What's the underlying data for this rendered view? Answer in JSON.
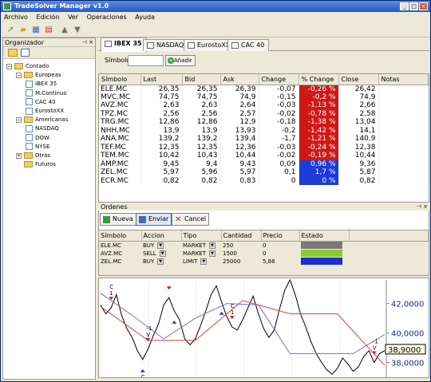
{
  "window": {
    "title": "TradeSolver Manager v1.0"
  },
  "titlebar_buttons": [
    "_",
    "□",
    "×"
  ],
  "menu": [
    "Archivo",
    "Edición",
    "Ver",
    "Operaciones",
    "Ayuda"
  ],
  "toolbar_icons": [
    "chart-new-icon",
    "folder-open-icon",
    "grid-icon",
    "chart-icon",
    "arrow-up-icon",
    "arrow-down-icon"
  ],
  "organizer": {
    "title": "Organizador",
    "header_icons": "⊣ ×",
    "tree": [
      {
        "label": "Contado",
        "level": 0,
        "kind": "folder",
        "expanded": true
      },
      {
        "label": "Europeas",
        "level": 1,
        "kind": "folder",
        "expanded": true
      },
      {
        "label": "IBEX 35",
        "level": 2,
        "kind": "doc"
      },
      {
        "label": "M.Continuo",
        "level": 2,
        "kind": "doc"
      },
      {
        "label": "CAC 40",
        "level": 2,
        "kind": "doc"
      },
      {
        "label": "EurostoXX",
        "level": 2,
        "kind": "doc"
      },
      {
        "label": "Americanas",
        "level": 1,
        "kind": "folder",
        "expanded": true
      },
      {
        "label": "NASDAQ",
        "level": 2,
        "kind": "doc"
      },
      {
        "label": "DOW",
        "level": 2,
        "kind": "doc"
      },
      {
        "label": "NYSE",
        "level": 2,
        "kind": "doc"
      },
      {
        "label": "Otras",
        "level": 1,
        "kind": "folder",
        "expanded": false
      },
      {
        "label": "Futuros",
        "level": 1,
        "kind": "folder"
      }
    ]
  },
  "tabs": [
    "IBEX 35",
    "NASDAQ",
    "EurostoXX",
    "CAC 40"
  ],
  "symbol_bar": {
    "label": "Símbolo",
    "value": "",
    "add_label": "Añadir"
  },
  "quotes": {
    "columns": [
      "Símbolo",
      "Last",
      "Bid",
      "Ask",
      "Change",
      "% Change",
      "Close",
      "Notas"
    ],
    "rows": [
      [
        "ELE.MC",
        "26,35",
        "26,35",
        "26,39",
        "-0,07",
        "-0,26 %",
        "26,42",
        ""
      ],
      [
        "MVC.MC",
        "74,75",
        "74,75",
        "74,9",
        "-0,15",
        "-0,2 %",
        "74,9",
        ""
      ],
      [
        "AVZ.MC",
        "2,63",
        "2,63",
        "2,64",
        "-0,03",
        "-1,13 %",
        "2,66",
        ""
      ],
      [
        "TPZ.MC",
        "2,56",
        "2,56",
        "2,57",
        "-0,02",
        "-0,78 %",
        "2,58",
        ""
      ],
      [
        "TRG.MC",
        "12,86",
        "12,86",
        "12,9",
        "-0,18",
        "-1,38 %",
        "13,04",
        ""
      ],
      [
        "NHH.MC",
        "13,9",
        "13,9",
        "13,93",
        "-0,2",
        "-1,42 %",
        "14,1",
        ""
      ],
      [
        "ANA.MC",
        "139,2",
        "139,2",
        "139,4",
        "-1,7",
        "-1,21 %",
        "140,9",
        ""
      ],
      [
        "TEF.MC",
        "12,35",
        "12,35",
        "12,36",
        "-0,03",
        "-0,24 %",
        "12,38",
        ""
      ],
      [
        "TEM.MC",
        "10,42",
        "10,43",
        "10,44",
        "-0,02",
        "-0,19 %",
        "10,44",
        ""
      ],
      [
        "AMP.MC",
        "9,45",
        "9,4",
        "9,43",
        "0,09",
        "0,96 %",
        "9,36",
        ""
      ],
      [
        "ZEL.MC",
        "5,97",
        "5,96",
        "5,97",
        "0,1",
        "1,7 %",
        "5,87",
        ""
      ],
      [
        "ECR.MC",
        "0,82",
        "0,82",
        "0,83",
        "0",
        "0 %",
        "0,82",
        ""
      ]
    ],
    "change_colors": {
      "down": "#d01818",
      "up": "#1c3cd8"
    }
  },
  "orders": {
    "title": "Ordenes",
    "header_icons": "⊣ ×",
    "buttons": {
      "new": "Nueva",
      "send": "Enviar",
      "cancel": "Cancel"
    },
    "columns": [
      "Símbolo",
      "Accion",
      "Tipo",
      "Cantidad",
      "Precio",
      "Estado"
    ],
    "rows": [
      {
        "symbol": "ELE.MC",
        "action": "BUY",
        "type": "MARKET",
        "qty": "250",
        "price": "0",
        "status_color": "#7a7a7a"
      },
      {
        "symbol": "AVZ.MC",
        "action": "SELL",
        "type": "MARKET",
        "qty": "1500",
        "price": "0",
        "status_color": "#8cc832"
      },
      {
        "symbol": "ZEL.MC",
        "action": "BUY",
        "type": "LIMIT",
        "qty": "25000",
        "price": "5,88",
        "status_color": "#1a2cd6"
      }
    ]
  },
  "chart_data": {
    "type": "line",
    "y_ticks": [
      "42,0000",
      "40,0000",
      "38,0000"
    ],
    "ylim": [
      37.0,
      43.6
    ],
    "last_value_label": "38,9000",
    "series": [
      {
        "values": [
          41.9,
          41.3,
          41.7,
          42.6,
          41.2,
          40.3,
          39.7,
          38.8,
          38.2,
          38.9,
          39.8,
          40.6,
          41.9,
          42.4,
          41.5,
          40.9,
          39.6,
          39.2,
          39.6,
          40.5,
          41.5,
          42.6,
          43.2,
          42.1,
          41.1,
          40.4,
          40.2,
          40.9,
          41.7,
          42.5,
          41.3,
          40.3,
          39.7,
          40.2,
          41.6,
          42.9,
          43.6,
          42.6,
          41.3,
          40.4,
          39.4,
          38.6,
          38.0,
          37.5,
          37.2,
          37.6,
          38.3,
          37.9,
          37.4,
          37.7,
          38.4,
          38.8,
          38.0,
          38.6,
          38.8
        ]
      },
      {
        "values": [
          42.7,
          41.2,
          39.6,
          41.0,
          42.0,
          41.9,
          38.6,
          38.6,
          38.6,
          39.9
        ]
      },
      {
        "values": [
          41.8,
          39.5,
          39.5,
          42.2,
          41.3,
          41.3,
          37.8
        ]
      }
    ],
    "signals": [
      {
        "x_index": 2,
        "dir": "down",
        "label": "C\n1"
      },
      {
        "x_index": 8,
        "dir": "up",
        "label": "C\n1"
      },
      {
        "x_index": 9,
        "dir": "down",
        "label": "-1\nV"
      },
      {
        "x_index": 13,
        "dir": "down",
        "label": ""
      },
      {
        "x_index": 14,
        "dir": "up",
        "label": ""
      },
      {
        "x_index": 25,
        "dir": "down",
        "label": "C\n1"
      },
      {
        "x_index": 23,
        "dir": "up",
        "label": ""
      },
      {
        "x_index": 52,
        "dir": "down",
        "label": "-1\nV"
      }
    ]
  }
}
